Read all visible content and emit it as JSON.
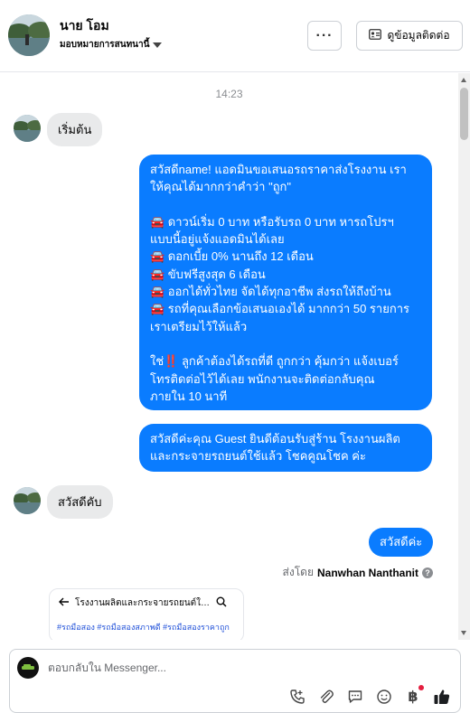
{
  "header": {
    "name": "นาย โอม",
    "assign_label": "มอบหมายการสนทนานี้",
    "more_label": "···",
    "contact_button_label": "ดูข้อมูลติดต่อ"
  },
  "chat": {
    "timestamp": "14:23",
    "messages": [
      {
        "direction": "incoming",
        "text": "เริ่มต้น"
      },
      {
        "direction": "outgoing",
        "lines": [
          "สวัสดีname! แอดมินขอเสนอรถราคาส่งโรงงาน เรา",
          "ให้คุณได้มากกว่าคำว่า \"ถูก\"",
          "",
          "🚘 ดาวน์เริ่ม 0 บาท หรือรับรถ 0 บาท หารถโปรฯ",
          "แบบนี้อยู่แจ้งแอดมินได้เลย",
          "🚘 ดอกเบี้ย 0% นานถึง 12 เดือน",
          "🚘 ขับฟรีสูงสุด 6 เดือน",
          "🚘 ออกได้ทั่วไทย จัดได้ทุกอาชีพ ส่งรถให้ถึงบ้าน",
          "🚘 รถที่คุณเลือกข้อเสนอเองได้ มากกว่า 50 รายการ",
          "เราเตรียมไว้ให้แล้ว",
          "",
          "ใช่‼️ ลูกค้าต้องได้รถที่ดี ถูกกว่า คุ้มกว่า แจ้งเบอร์",
          "โทรติดต่อไว้ได้เลย พนักงานจะติดต่อกลับคุณ",
          "ภายใน 10 นาที"
        ]
      },
      {
        "direction": "outgoing",
        "lines": [
          "สวัสดีค่ะคุณ Guest ยินดีต้อนรับสู่ร้าน โรงงานผลิต",
          "และกระจายรถยนต์ใช้แล้ว โชคคูณโชค ค่ะ"
        ]
      },
      {
        "direction": "incoming",
        "text": "สวัสดีคับ"
      },
      {
        "direction": "outgoing",
        "text": "สวัสดีค่ะ"
      }
    ],
    "sent_by_prefix": "ส่งโดย",
    "sent_by_name": "Nanwhan Nanthanit",
    "preview": {
      "title": "โรงงานผลิตและกระจายรถยนต์ใช้แล้ว โชคคูณโชค",
      "tags": "#รถมือสอง #รถมือสองสภาพดี #รถมือสองราคาถูก"
    }
  },
  "composer": {
    "placeholder": "ตอบกลับใน Messenger...",
    "currency_symbol": "฿"
  },
  "colors": {
    "outgoing_bubble": "#0a7cff",
    "incoming_bubble": "#e9eaeb",
    "like_icon": "#1c1e21"
  }
}
